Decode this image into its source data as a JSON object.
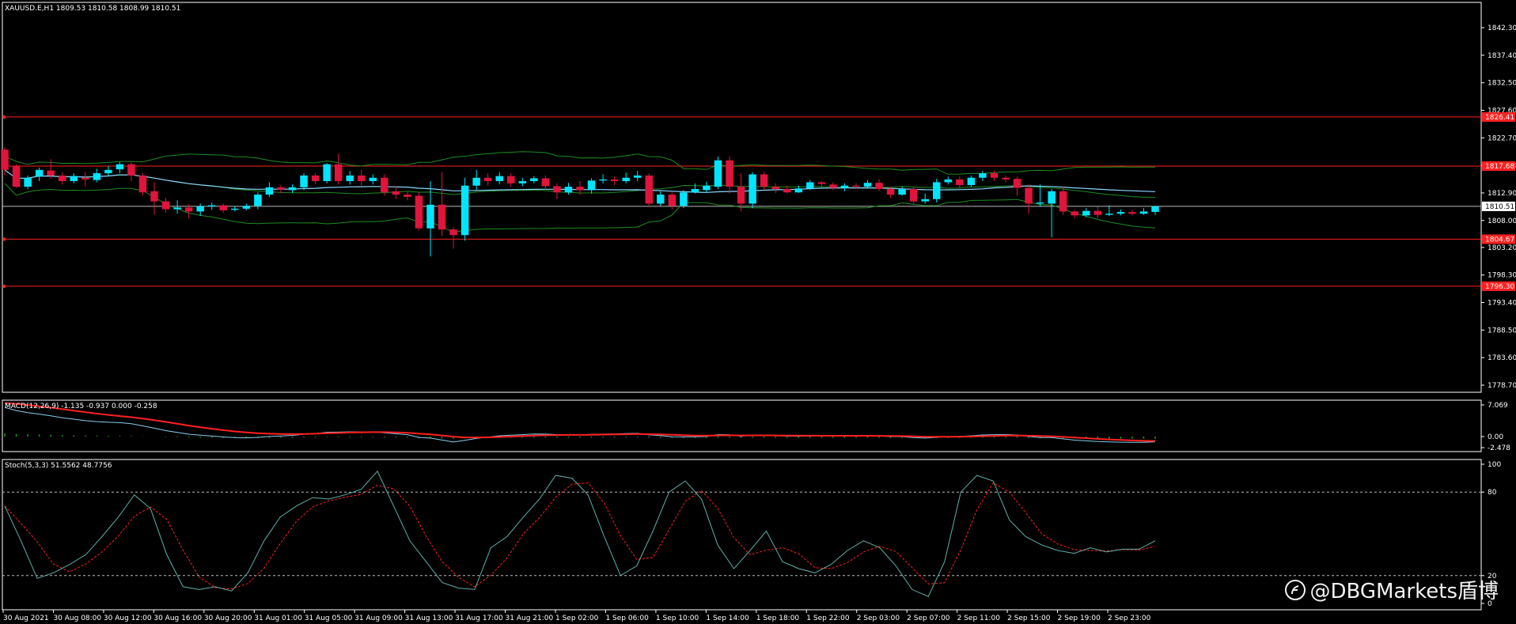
{
  "colors": {
    "background": "#000000",
    "bull": "#00e5ff",
    "bear": "#e0143c",
    "level_line": "#ff2020",
    "bands": "#1e8c1e",
    "ma": "#8ad8ff",
    "macd_main": "#87ceeb",
    "macd_signal": "#ff2020",
    "macd_hist": "#1e9c1e",
    "stoch_main": "#5fb0a8",
    "stoch_signal": "#ff2020",
    "grid_text": "#ffffff"
  },
  "chart_data": [
    {
      "type": "candlestick",
      "header": "XAUUSD.E,H1  1809.53 1810.58 1808.99 1810.51",
      "y_ticks": [
        "1842.30",
        "1837.40",
        "1832.50",
        "1827.60",
        "1822.70",
        "1817.80",
        "1812.90",
        "1808.00",
        "1803.20",
        "1798.30",
        "1793.40",
        "1788.50",
        "1783.60",
        "1778.70"
      ],
      "ylim": [
        1778.7,
        1846.0
      ],
      "levels": [
        {
          "label": "1826.41",
          "value": 1826.41
        },
        {
          "label": "1817.68",
          "value": 1817.68
        },
        {
          "label": "1804.67",
          "value": 1804.67
        },
        {
          "label": "1796.30",
          "value": 1796.3
        }
      ],
      "current_price": {
        "label": "1810.51",
        "value": 1810.51
      },
      "candles": [
        [
          1820.6,
          1817.0,
          1821.0,
          1816.0
        ],
        [
          1817.6,
          1814.0,
          1818.0,
          1813.8
        ],
        [
          1814.0,
          1815.6,
          1816.0,
          1813.6
        ],
        [
          1815.8,
          1817.0,
          1817.4,
          1815.0
        ],
        [
          1816.9,
          1816.0,
          1818.9,
          1815.4
        ],
        [
          1816.0,
          1815.0,
          1816.6,
          1814.4
        ],
        [
          1815.0,
          1815.9,
          1816.4,
          1814.6
        ],
        [
          1815.6,
          1815.3,
          1816.6,
          1814.0
        ],
        [
          1815.2,
          1816.4,
          1817.2,
          1814.8
        ],
        [
          1816.4,
          1817.0,
          1817.7,
          1815.9
        ],
        [
          1817.1,
          1818.0,
          1818.4,
          1816.4
        ],
        [
          1818.0,
          1816.0,
          1818.4,
          1815.0
        ],
        [
          1816.0,
          1813.0,
          1816.4,
          1812.4
        ],
        [
          1813.2,
          1811.4,
          1814.8,
          1809.0
        ],
        [
          1811.4,
          1810.0,
          1812.0,
          1809.4
        ],
        [
          1810.0,
          1810.3,
          1811.6,
          1809.2
        ],
        [
          1810.3,
          1809.6,
          1810.9,
          1808.4
        ],
        [
          1809.6,
          1810.5,
          1811.0,
          1808.8
        ],
        [
          1810.5,
          1810.7,
          1811.2,
          1809.9
        ],
        [
          1810.7,
          1809.8,
          1811.0,
          1809.4
        ],
        [
          1809.9,
          1810.1,
          1810.6,
          1809.6
        ],
        [
          1810.1,
          1810.6,
          1811.0,
          1809.8
        ],
        [
          1810.6,
          1812.6,
          1813.0,
          1810.0
        ],
        [
          1812.6,
          1813.9,
          1814.8,
          1812.2
        ],
        [
          1813.9,
          1813.5,
          1814.3,
          1812.8
        ],
        [
          1813.4,
          1813.9,
          1814.4,
          1812.9
        ],
        [
          1813.9,
          1816.0,
          1816.4,
          1813.4
        ],
        [
          1816.0,
          1815.0,
          1816.4,
          1814.4
        ],
        [
          1815.0,
          1818.0,
          1818.2,
          1814.6
        ],
        [
          1818.0,
          1815.0,
          1819.9,
          1814.4
        ],
        [
          1815.0,
          1816.0,
          1816.8,
          1814.4
        ],
        [
          1816.0,
          1815.0,
          1817.0,
          1814.2
        ],
        [
          1815.0,
          1815.6,
          1816.2,
          1814.4
        ],
        [
          1815.6,
          1813.0,
          1816.2,
          1812.4
        ],
        [
          1813.2,
          1812.6,
          1814.2,
          1811.8
        ],
        [
          1812.6,
          1812.2,
          1813.0,
          1811.6
        ],
        [
          1812.4,
          1806.6,
          1813.0,
          1806.2
        ],
        [
          1806.6,
          1810.8,
          1815.0,
          1801.6
        ],
        [
          1810.8,
          1806.4,
          1816.6,
          1805.2
        ],
        [
          1806.4,
          1805.4,
          1806.8,
          1803.0
        ],
        [
          1805.4,
          1814.2,
          1815.6,
          1804.4
        ],
        [
          1814.2,
          1815.6,
          1817.0,
          1813.4
        ],
        [
          1815.6,
          1815.0,
          1816.4,
          1814.2
        ],
        [
          1815.0,
          1815.9,
          1816.6,
          1814.4
        ],
        [
          1815.9,
          1814.6,
          1816.4,
          1814.0
        ],
        [
          1814.6,
          1815.0,
          1815.6,
          1814.1
        ],
        [
          1815.0,
          1815.5,
          1815.9,
          1814.6
        ],
        [
          1815.5,
          1814.1,
          1816.0,
          1813.4
        ],
        [
          1814.1,
          1813.0,
          1814.6,
          1811.8
        ],
        [
          1813.0,
          1814.0,
          1814.7,
          1812.6
        ],
        [
          1814.0,
          1813.4,
          1815.0,
          1812.6
        ],
        [
          1813.4,
          1815.1,
          1815.5,
          1812.8
        ],
        [
          1815.1,
          1815.3,
          1816.2,
          1814.6
        ],
        [
          1815.3,
          1815.0,
          1815.8,
          1814.3
        ],
        [
          1815.0,
          1815.6,
          1816.5,
          1814.6
        ],
        [
          1815.6,
          1816.0,
          1816.8,
          1815.0
        ],
        [
          1816.0,
          1811.0,
          1816.4,
          1810.4
        ],
        [
          1811.0,
          1812.6,
          1813.2,
          1810.6
        ],
        [
          1812.6,
          1810.6,
          1813.0,
          1810.0
        ],
        [
          1810.6,
          1813.0,
          1813.4,
          1810.2
        ],
        [
          1813.0,
          1813.6,
          1814.6,
          1812.8
        ],
        [
          1813.4,
          1814.2,
          1814.9,
          1812.9
        ],
        [
          1814.0,
          1818.7,
          1819.4,
          1813.6
        ],
        [
          1818.7,
          1814.0,
          1819.4,
          1812.8
        ],
        [
          1814.0,
          1811.0,
          1816.4,
          1809.6
        ],
        [
          1811.0,
          1816.2,
          1816.6,
          1810.2
        ],
        [
          1816.2,
          1814.0,
          1816.6,
          1813.4
        ],
        [
          1814.0,
          1813.6,
          1814.6,
          1812.9
        ],
        [
          1813.6,
          1813.0,
          1814.2,
          1812.8
        ],
        [
          1813.0,
          1813.7,
          1814.2,
          1812.9
        ],
        [
          1813.7,
          1814.8,
          1815.2,
          1813.4
        ],
        [
          1814.8,
          1814.5,
          1815.0,
          1813.9
        ],
        [
          1814.4,
          1813.8,
          1814.8,
          1813.4
        ],
        [
          1813.8,
          1814.2,
          1814.6,
          1813.2
        ],
        [
          1814.2,
          1814.0,
          1814.6,
          1813.6
        ],
        [
          1814.0,
          1814.7,
          1815.2,
          1813.8
        ],
        [
          1814.7,
          1813.6,
          1815.4,
          1813.2
        ],
        [
          1813.6,
          1812.6,
          1814.0,
          1812.0
        ],
        [
          1812.6,
          1813.6,
          1814.0,
          1812.4
        ],
        [
          1813.6,
          1811.4,
          1814.0,
          1810.8
        ],
        [
          1811.4,
          1811.8,
          1812.8,
          1811.0
        ],
        [
          1811.8,
          1814.8,
          1815.4,
          1811.2
        ],
        [
          1814.8,
          1815.3,
          1815.8,
          1814.4
        ],
        [
          1815.3,
          1814.3,
          1815.8,
          1813.8
        ],
        [
          1814.3,
          1815.6,
          1816.0,
          1814.0
        ],
        [
          1815.6,
          1816.4,
          1816.8,
          1815.0
        ],
        [
          1816.4,
          1815.6,
          1816.9,
          1815.0
        ],
        [
          1815.6,
          1815.3,
          1816.0,
          1814.8
        ],
        [
          1815.4,
          1813.8,
          1815.8,
          1812.4
        ],
        [
          1813.8,
          1811.0,
          1814.4,
          1809.2
        ],
        [
          1811.0,
          1811.2,
          1814.4,
          1810.4
        ],
        [
          1811.0,
          1813.2,
          1813.6,
          1805.0
        ],
        [
          1813.2,
          1809.6,
          1814.0,
          1809.0
        ],
        [
          1809.6,
          1808.9,
          1809.9,
          1808.4
        ],
        [
          1808.9,
          1809.7,
          1810.2,
          1808.6
        ],
        [
          1809.7,
          1809.0,
          1810.4,
          1808.4
        ],
        [
          1809.0,
          1809.2,
          1810.7,
          1808.8
        ],
        [
          1809.2,
          1809.5,
          1810.0,
          1808.9
        ],
        [
          1809.5,
          1809.2,
          1809.9,
          1808.9
        ],
        [
          1809.2,
          1809.6,
          1810.2,
          1809.0
        ],
        [
          1809.53,
          1810.51,
          1810.58,
          1808.99
        ]
      ],
      "indicators": [
        "Bollinger Bands",
        "Moving Average"
      ]
    },
    {
      "type": "line",
      "name": "MACD",
      "header": "MACD(12,26,9) -1.135 -0.937 0.000 -0.258",
      "y_ticks": [
        "7.069",
        "0.00",
        "-2.478"
      ],
      "ylim": [
        -2.478,
        7.069
      ]
    },
    {
      "type": "line",
      "name": "Stochastic",
      "header": "Stoch(5,3,3) 51.5562 48.7756",
      "y_ticks": [
        "100",
        "80",
        "20",
        "0"
      ],
      "ylim": [
        0,
        100
      ],
      "main": [
        70,
        45,
        18,
        22,
        28,
        35,
        48,
        62,
        78,
        68,
        35,
        12,
        10,
        12,
        9,
        22,
        45,
        62,
        70,
        76,
        75,
        78,
        82,
        95,
        70,
        45,
        30,
        15,
        11,
        10,
        40,
        48,
        62,
        75,
        92,
        90,
        78,
        48,
        20,
        27,
        52,
        80,
        88,
        75,
        42,
        25,
        38,
        52,
        30,
        25,
        22,
        28,
        38,
        45,
        40,
        27,
        10,
        5,
        30,
        80,
        92,
        88,
        60,
        48,
        42,
        38,
        36,
        40,
        37,
        39,
        39,
        45
      ]
    }
  ],
  "x_labels": [
    "30 Aug 2021",
    "30 Aug 08:00",
    "30 Aug 12:00",
    "30 Aug 16:00",
    "30 Aug 20:00",
    "31 Aug 01:00",
    "31 Aug 05:00",
    "31 Aug 09:00",
    "31 Aug 13:00",
    "31 Aug 17:00",
    "31 Aug 21:00",
    "1 Sep 02:00",
    "1 Sep 06:00",
    "1 Sep 10:00",
    "1 Sep 14:00",
    "1 Sep 18:00",
    "1 Sep 22:00",
    "2 Sep 03:00",
    "2 Sep 07:00",
    "2 Sep 11:00",
    "2 Sep 15:00",
    "2 Sep 19:00",
    "2 Sep 23:00"
  ],
  "watermark": {
    "text": "@DBGMarkets盾博",
    "icon": "weibo-icon"
  }
}
